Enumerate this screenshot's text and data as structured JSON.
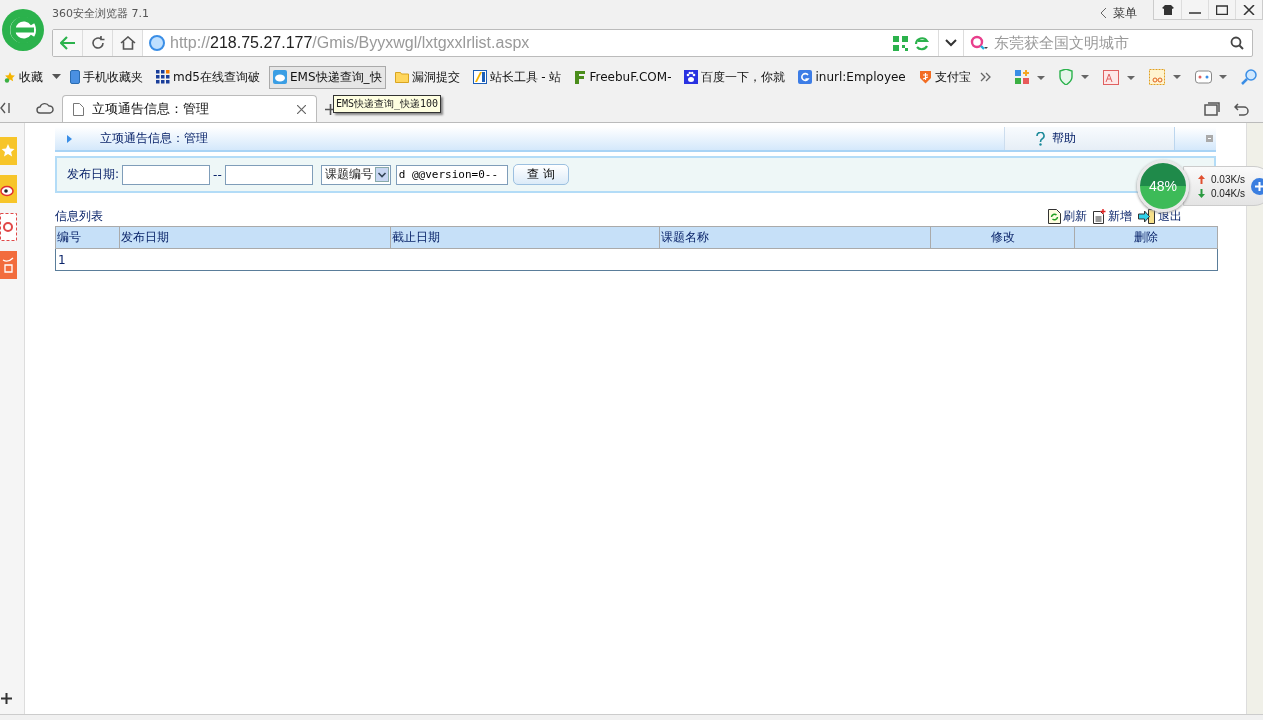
{
  "browser": {
    "title": "360安全浏览器 7.1",
    "menu": "菜单",
    "url_prefix": "http://",
    "url_host": "218.75.27.177",
    "url_path": "/Gmis/Byyxwgl/lxtgxxlrlist.aspx",
    "search_placeholder": "东莞获全国文明城市"
  },
  "bookmarks": [
    {
      "kind": "star",
      "label": "收藏",
      "highlighted": false
    },
    {
      "kind": "phone",
      "label": "手机收藏夹",
      "highlighted": false
    },
    {
      "kind": "grid",
      "label": "md5在线查询破",
      "highlighted": false
    },
    {
      "kind": "ems",
      "label": "EMS快递查询_快",
      "highlighted": true
    },
    {
      "kind": "folder",
      "label": "漏洞提交",
      "highlighted": false
    },
    {
      "kind": "tool",
      "label": "站长工具 - 站",
      "highlighted": false
    },
    {
      "kind": "freebuf",
      "label": "FreebuF.COM-",
      "highlighted": false
    },
    {
      "kind": "paw",
      "label": "百度一下，你就",
      "highlighted": false
    },
    {
      "kind": "g",
      "label": "inurl:Employee",
      "highlighted": false
    },
    {
      "kind": "alipay",
      "label": "支付宝",
      "highlighted": false
    }
  ],
  "tabs": [
    {
      "label": "立项通告信息：管理",
      "selected": true
    }
  ],
  "tooltip": "EMS快递查询_快递100",
  "page": {
    "header_title": "立项通告信息：管理",
    "help": "帮助",
    "filter": {
      "label": "发布日期:",
      "separator": "--",
      "select": "课题编号",
      "keyword": "d @@version=0--",
      "button": "查 询"
    },
    "list_title": "信息列表",
    "actions": [
      {
        "kind": "refresh",
        "label": "刷新"
      },
      {
        "kind": "add",
        "label": "新增"
      },
      {
        "kind": "exit",
        "label": "退出"
      }
    ],
    "table": {
      "columns": [
        {
          "label": "编号",
          "kind": "data"
        },
        {
          "label": "发布日期",
          "kind": "data"
        },
        {
          "label": "截止日期",
          "kind": "data"
        },
        {
          "label": "课题名称",
          "kind": "data"
        },
        {
          "label": "修改",
          "kind": "action"
        },
        {
          "label": "删除",
          "kind": "action"
        }
      ],
      "rows": [
        [
          "1"
        ]
      ]
    }
  },
  "speed": {
    "percent": "48%",
    "up": "0.03K/s",
    "down": "0.04K/s"
  }
}
